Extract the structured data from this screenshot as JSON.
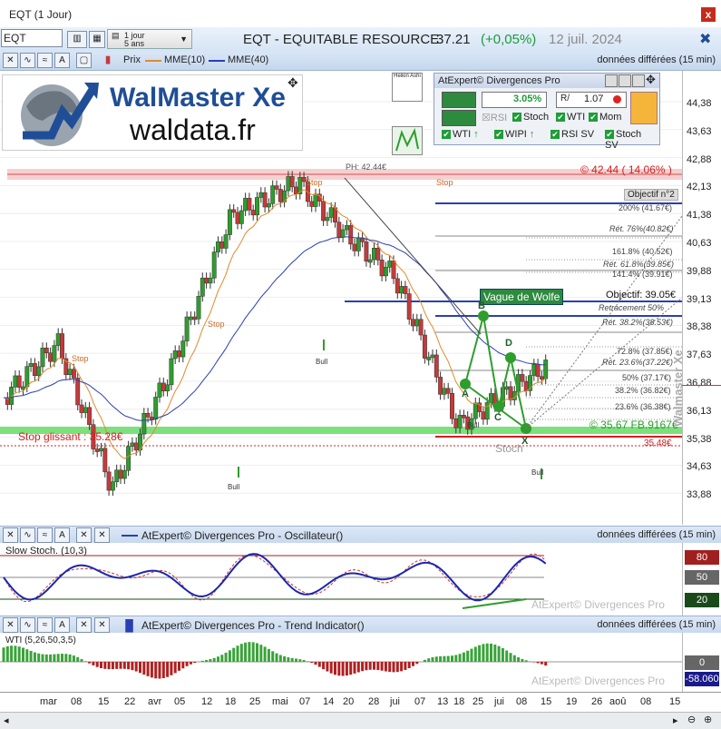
{
  "window": {
    "title": "EQT (1 Jour)",
    "close": "x"
  },
  "toolbar": {
    "symbol": "EQT",
    "period_main": "1 jour",
    "period_sub": "5 ans",
    "instrument": "EQT - EQUITABLE RESOURCE",
    "price": "37.21",
    "change": "(+0,05%)",
    "date": "12 juil. 2024"
  },
  "toolbar2": {
    "prix": "Prix",
    "mme10": "MME(10)",
    "mme40": "MME(40)",
    "delayed": "données différées (15 min)"
  },
  "logo": {
    "line1": "WalMaster Xe",
    "line2": "waldata.fr",
    "heikin": "Heikin Ashi"
  },
  "divpanel": {
    "title": "AtExpert© Divergences Pro",
    "pct": "3.05%",
    "ratio": "1.07",
    "r1": [
      "RSI",
      "Stoch",
      "WTI",
      "Mom"
    ],
    "r2": [
      "WTI",
      "WIPI",
      "RSI SV",
      "Stoch SV"
    ]
  },
  "chart_labels": {
    "ph": "PH: 42.44€",
    "ph_box": "© 42.44 ( 14.06% )",
    "objectif2": "Objectif n°2",
    "lvl_200": "200% (41.67€)",
    "ret76": "Rét. 76%(40.82€)",
    "lvl_161": "161.8% (40.52€)",
    "ret618": "Rét. 61.8%(39.85€)",
    "lvl_141": "141.4% (39.91€)",
    "vague": "Vague de Wolfe",
    "objectif": "Objectif: 39.05€",
    "retr50": "Retracement 50%",
    "ret382": "Rét. 38.2%(38.53€)",
    "lvl_728": "72.8% (37.85€)",
    "ret236": "Rét. 23.6%(37.22€)",
    "lvl_50": "50% (37.17€)",
    "lvl_382": "38.2% (36.82€)",
    "lvl_236": "23.6% (36.38€)",
    "support": "© 35.67 FB.9167€",
    "stop_glissant": "Stop glissant : 35.28€",
    "stop_box": "35.48€",
    "stoch": "Stoch",
    "stop": "Stop",
    "bull": "Bull",
    "A": "A",
    "B": "B",
    "C": "C",
    "D": "D",
    "X": "X",
    "trend_name": "Walmaster Xe"
  },
  "price_axis": [
    "44,38",
    "43,63",
    "42,88",
    "42,13",
    "41,38",
    "40,63",
    "39,88",
    "39,13",
    "38,38",
    "37,63",
    "36,88",
    "36,13",
    "35,38",
    "34,63",
    "33,88"
  ],
  "osc": {
    "bar_title": "AtExpert© Divergences Pro - Oscillateur()",
    "delayed": "données différées (15 min)",
    "label": "Slow Stoch. (10,3)",
    "watermark": "AtExpert© Divergences Pro",
    "levels": [
      "80",
      "50",
      "20"
    ]
  },
  "trend": {
    "bar_title": "AtExpert© Divergences Pro - Trend Indicator()",
    "delayed": "données différées (15 min)",
    "label": "WTI (5,26,50,3,5)",
    "watermark": "AtExpert© Divergences Pro",
    "levels": [
      "0",
      "-58.060"
    ]
  },
  "time_axis": [
    "mar",
    "08",
    "15",
    "22",
    "avr",
    "05",
    "12",
    "18",
    "25",
    "mai",
    "07",
    "14",
    "20",
    "28",
    "jui",
    "07",
    "13",
    "18",
    "25",
    "jui",
    "08",
    "15",
    "19",
    "26",
    "aoû",
    "08",
    "15"
  ],
  "colors": {
    "up": "#2e9d2e",
    "down": "#c43a3a",
    "ema10": "#e08a2a",
    "ema40": "#2a3fb0",
    "accent": "#1f4e96"
  }
}
